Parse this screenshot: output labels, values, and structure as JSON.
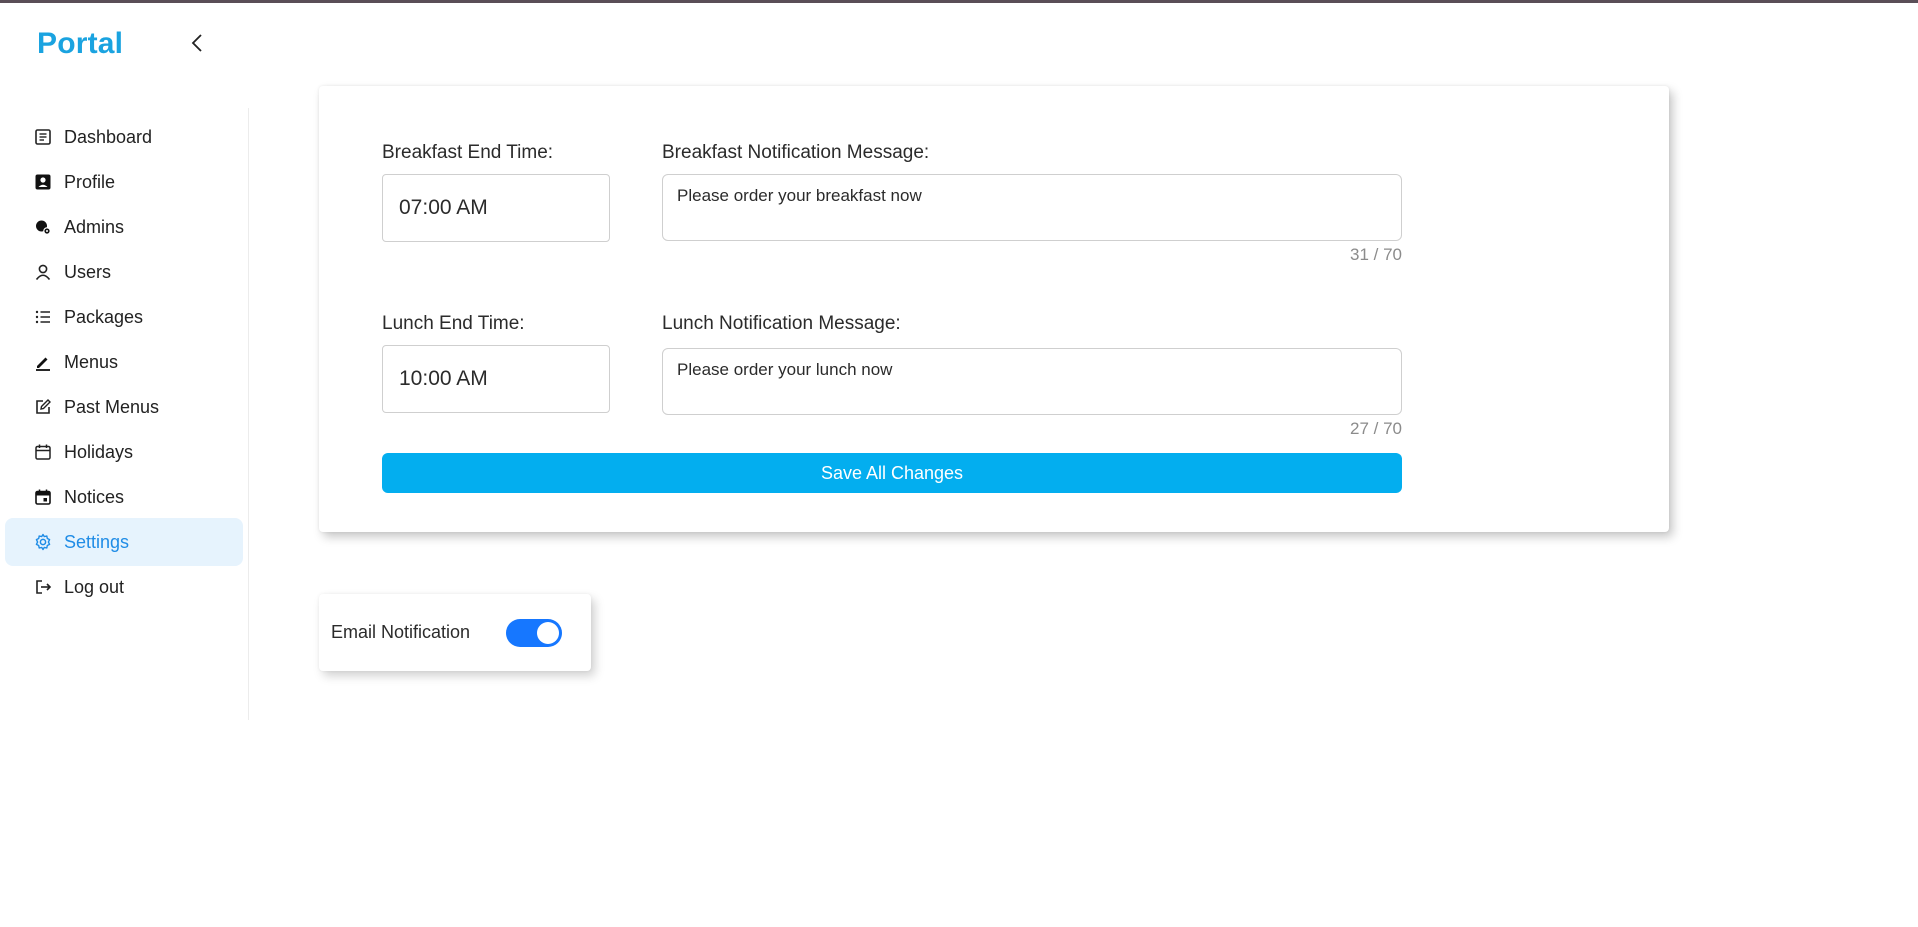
{
  "app": {
    "brand": "Portal",
    "brand_color": "#1aa3e0"
  },
  "sidebar": {
    "collapse_icon": "chevron-left-icon",
    "items": [
      {
        "label": "Dashboard",
        "icon": "dashboard-icon",
        "active": false
      },
      {
        "label": "Profile",
        "icon": "profile-icon",
        "active": false
      },
      {
        "label": "Admins",
        "icon": "admins-icon",
        "active": false
      },
      {
        "label": "Users",
        "icon": "user-icon",
        "active": false
      },
      {
        "label": "Packages",
        "icon": "list-icon",
        "active": false
      },
      {
        "label": "Menus",
        "icon": "pen-icon",
        "active": false
      },
      {
        "label": "Past Menus",
        "icon": "edit-icon",
        "active": false
      },
      {
        "label": "Holidays",
        "icon": "calendar-icon",
        "active": false
      },
      {
        "label": "Notices",
        "icon": "calendar-event-icon",
        "active": false
      },
      {
        "label": "Settings",
        "icon": "gear-icon",
        "active": true
      },
      {
        "label": "Log out",
        "icon": "logout-icon",
        "active": false
      }
    ],
    "active_color": "#1f8ce6",
    "active_bg": "#e6f3fd"
  },
  "settings": {
    "breakfast": {
      "time_label": "Breakfast End Time:",
      "time_value": "07:00 AM",
      "message_label": "Breakfast Notification Message:",
      "message_value": "Please order your breakfast now",
      "counter": "31 / 70"
    },
    "lunch": {
      "time_label": "Lunch End Time:",
      "time_value": "10:00 AM",
      "message_label": "Lunch Notification Message:",
      "message_value": "Please order your lunch now",
      "counter": "27 / 70"
    },
    "save_label": "Save All Changes",
    "save_color": "#03aeef"
  },
  "email_notification": {
    "label": "Email Notification",
    "enabled": true,
    "toggle_color": "#1677ff"
  }
}
